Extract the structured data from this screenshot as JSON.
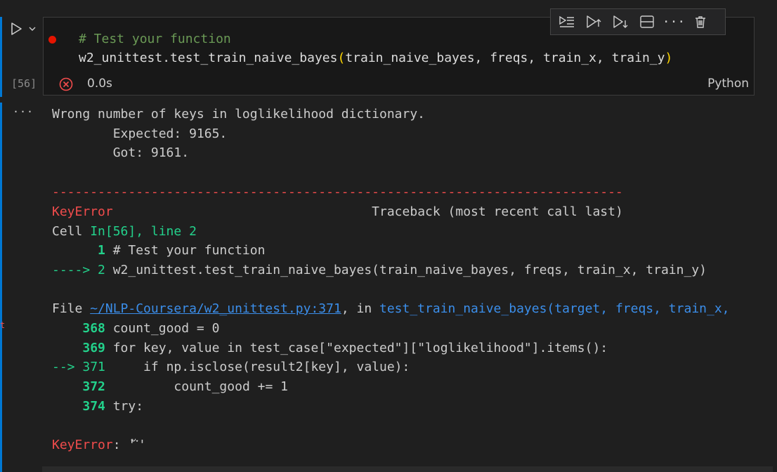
{
  "cell": {
    "execution_count": "[56]",
    "code_lines": [
      "# Test your function",
      "w2_unittest.test_train_naive_bayes",
      "(",
      "train_naive_bayes, freqs, train_x, train_y",
      ")"
    ],
    "duration": "0.0s",
    "language": "Python",
    "output_more": "···"
  },
  "toolbar": {
    "items": [
      "run-by-line-icon",
      "execute-above-icon",
      "execute-below-icon",
      "split-cell-icon",
      "more-icon",
      "delete-icon"
    ],
    "more_label": "···"
  },
  "stray_mark": "t",
  "output": {
    "l1": "Wrong number of keys in loglikelihood dictionary.",
    "l2": "        Expected: 9165.",
    "l3": "        Got: 9161.",
    "separator": "---------------------------------------------------------------------------",
    "error_name": "KeyError",
    "traceback_header_pad": "                                  ",
    "traceback_header": "Traceback (most recent call last)",
    "cell_prefix": "Cell ",
    "cell_ref": "In[56], line 2",
    "tb1_num": "      1",
    "tb1_code": " # Test your function",
    "tb2_arrow": "----> 2",
    "tb2_code": " w2_unittest.test_train_naive_bayes(train_naive_bayes, freqs, train_x, train_y)",
    "file_prefix": "File ",
    "file_link": "~/NLP-Coursera/w2_unittest.py:371",
    "file_in": ", in ",
    "file_func": "test_train_naive_bayes(target, freqs, train_x,",
    "src": [
      {
        "prefix": "    ",
        "num": "368",
        "code": " count_good = 0"
      },
      {
        "prefix": "    ",
        "num": "369",
        "code": " for key, value in test_case[\"expected\"][\"loglikelihood\"].items():"
      },
      {
        "prefix": "--> ",
        "num": "371",
        "code": "     if np.isclose(result2[key], value):"
      },
      {
        "prefix": "    ",
        "num": "372",
        "code": "         count_good += 1"
      },
      {
        "prefix": "    ",
        "num": "374",
        "code": " try:"
      }
    ],
    "final_error": "KeyError",
    "final_msg": ": 'ั་'"
  }
}
